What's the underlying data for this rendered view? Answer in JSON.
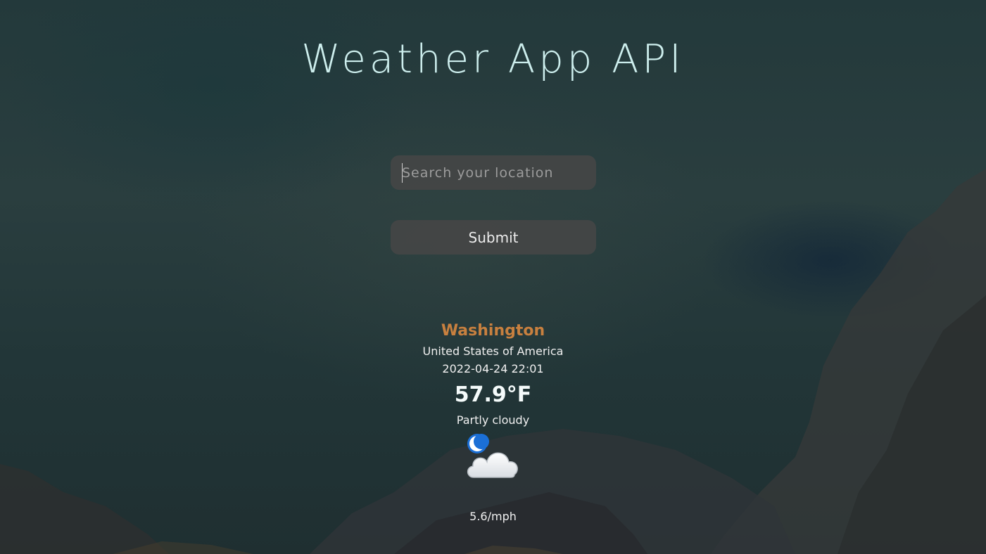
{
  "app": {
    "title": "Weather App API"
  },
  "search": {
    "placeholder": "Search your location",
    "value": ""
  },
  "submit": {
    "label": "Submit"
  },
  "weather": {
    "city": "Washington",
    "country": "United States of America",
    "datetime": "2022-04-24 22:01",
    "temperature": "57.9°F",
    "condition": "Partly cloudy",
    "icon": "moon-cloud-icon",
    "wind": "5.6/mph"
  },
  "colors": {
    "title": "#cdeeed",
    "city": "#c8803f",
    "control_bg": "#464646"
  }
}
